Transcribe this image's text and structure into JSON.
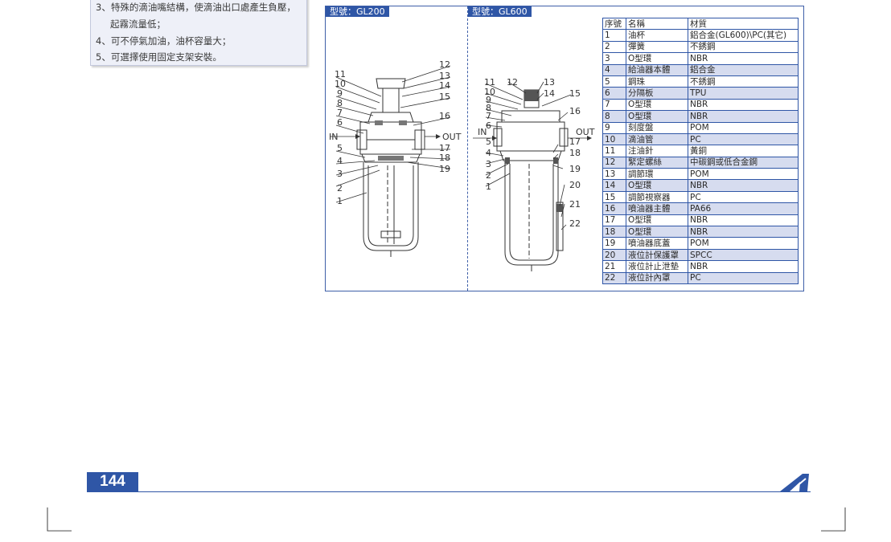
{
  "features": [
    "3、特殊的滴油嘴結構，使滴油出口處產生負壓，",
    "起霧流量低；",
    "4、可不停氣加油，油杯容量大；",
    "5、可選擇使用固定支架安裝。"
  ],
  "models": {
    "gl200": "型號：GL200",
    "gl600": "型號：GL600"
  },
  "ports": {
    "in": "IN",
    "out": "OUT"
  },
  "gl200_parts": [
    "1",
    "2",
    "3",
    "4",
    "5",
    "6",
    "7",
    "8",
    "9",
    "10",
    "11",
    "12",
    "13",
    "14",
    "15",
    "16",
    "17",
    "18",
    "19"
  ],
  "gl600_parts": [
    "1",
    "2",
    "3",
    "4",
    "5",
    "6",
    "7",
    "8",
    "9",
    "10",
    "11",
    "12",
    "13",
    "14",
    "15",
    "16",
    "17",
    "18",
    "19",
    "20",
    "21",
    "22"
  ],
  "parts_table": {
    "headers": [
      "序號",
      "名稱",
      "材質"
    ],
    "rows": [
      [
        "1",
        "油杯",
        "鋁合金(GL600)\\PC(其它)"
      ],
      [
        "2",
        "彈簧",
        "不銹鋼"
      ],
      [
        "3",
        "O型環",
        "NBR"
      ],
      [
        "4",
        "給油器本體",
        "鋁合金"
      ],
      [
        "5",
        "鋼珠",
        "不銹鋼"
      ],
      [
        "6",
        "分隔板",
        "TPU"
      ],
      [
        "7",
        "O型環",
        "NBR"
      ],
      [
        "8",
        "O型環",
        "NBR"
      ],
      [
        "9",
        "刻度盤",
        "POM"
      ],
      [
        "10",
        "滴油管",
        "PC"
      ],
      [
        "11",
        "注油針",
        "黃銅"
      ],
      [
        "12",
        "緊定螺絲",
        "中碳鋼或低合金鋼"
      ],
      [
        "13",
        "調節環",
        "POM"
      ],
      [
        "14",
        "O型環",
        "NBR"
      ],
      [
        "15",
        "調節視察器",
        "PC"
      ],
      [
        "16",
        "噴油器主體",
        "PA66"
      ],
      [
        "17",
        "O型環",
        "NBR"
      ],
      [
        "18",
        "O型環",
        "NBR"
      ],
      [
        "19",
        "噴油器底蓋",
        "POM"
      ],
      [
        "20",
        "液位計保護罩",
        "SPCC"
      ],
      [
        "21",
        "液位計止泄墊",
        "NBR"
      ],
      [
        "22",
        "液位計內罩",
        "PC"
      ]
    ]
  },
  "page_number": "144",
  "colors": {
    "accent": "#2f56a6",
    "shade": "#d6dcef",
    "box_bg": "#eef0f8"
  }
}
